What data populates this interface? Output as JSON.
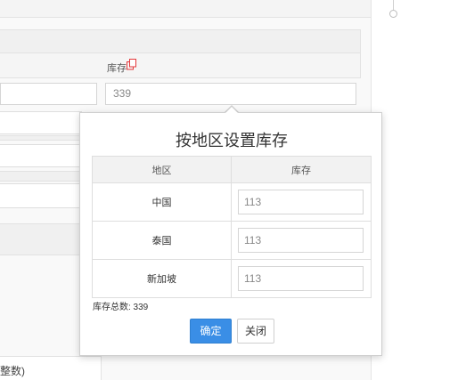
{
  "background": {
    "stock_header_label": "库存",
    "stock_input_value": "339",
    "bottom_partial_text": "整数)"
  },
  "popover": {
    "title": "按地区设置库存",
    "columns": {
      "region": "地区",
      "stock": "库存"
    },
    "rows": [
      {
        "region": "中国",
        "stock": "113"
      },
      {
        "region": "泰国",
        "stock": "113"
      },
      {
        "region": "新加坡",
        "stock": "113"
      }
    ],
    "total_label": "库存总数: 339",
    "confirm_label": "确定",
    "close_label": "关闭"
  },
  "colors": {
    "primary_button": "#3a8ee6",
    "copy_icon": "#e4393c"
  }
}
